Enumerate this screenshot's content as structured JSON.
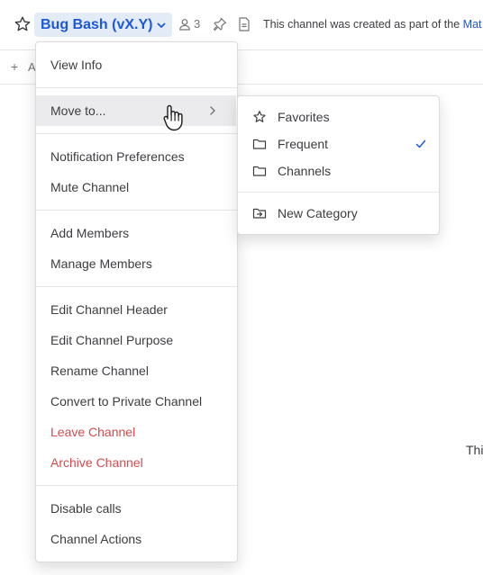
{
  "header": {
    "channel_name": "Bug Bash (vX.Y)",
    "member_count": "3",
    "description_prefix": "This channel was created as part of the ",
    "description_link": "Mat"
  },
  "subbar": {
    "add_label": "A"
  },
  "background_text": "Thi",
  "menu": {
    "view_info": "View Info",
    "move_to": "Move to...",
    "notification_preferences": "Notification Preferences",
    "mute_channel": "Mute Channel",
    "add_members": "Add Members",
    "manage_members": "Manage Members",
    "edit_channel_header": "Edit Channel Header",
    "edit_channel_purpose": "Edit Channel Purpose",
    "rename_channel": "Rename Channel",
    "convert_to_private": "Convert to Private Channel",
    "leave_channel": "Leave Channel",
    "archive_channel": "Archive Channel",
    "disable_calls": "Disable calls",
    "channel_actions": "Channel Actions"
  },
  "submenu": {
    "favorites": "Favorites",
    "frequent": "Frequent",
    "channels": "Channels",
    "new_category": "New Category",
    "selected": "Frequent"
  },
  "colors": {
    "accent": "#1c58d9",
    "danger": "#d24b4e",
    "hover": "#ebebed"
  }
}
